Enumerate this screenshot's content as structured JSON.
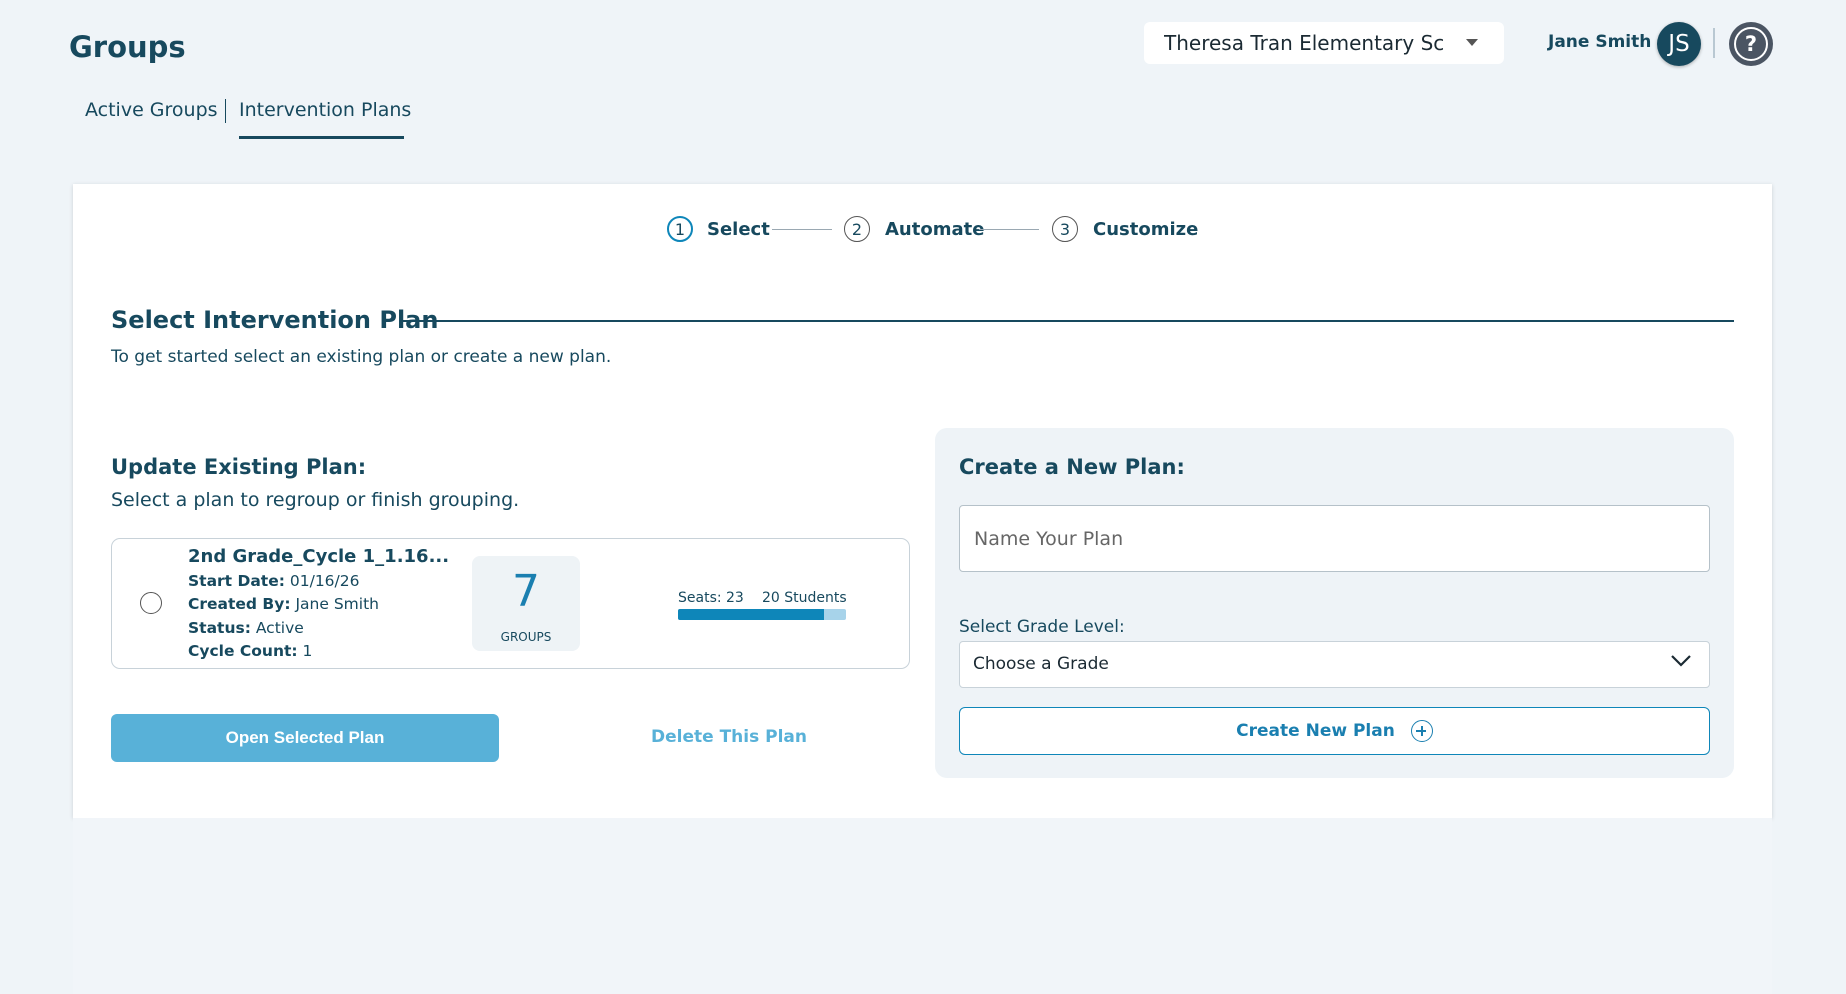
{
  "header": {
    "title": "Groups",
    "school": "Theresa Tran Elementary School",
    "user_name": "Jane Smith",
    "user_initials": "JS",
    "help_glyph": "?"
  },
  "tabs": [
    {
      "label": "Active Groups",
      "active": false
    },
    {
      "label": "Intervention Plans",
      "active": true
    }
  ],
  "steps": [
    {
      "number": "1",
      "label": "Select",
      "active": true
    },
    {
      "number": "2",
      "label": "Automate",
      "active": false
    },
    {
      "number": "3",
      "label": "Customize",
      "active": false
    }
  ],
  "section": {
    "title": "Select Intervention Plan",
    "subtitle": "To get started select an existing plan or create a new plan."
  },
  "update": {
    "heading": "Update Existing Plan:",
    "subtitle": "Select a plan to regroup or finish grouping.",
    "plan": {
      "name": "2nd Grade_Cycle 1_1.16...",
      "start_date_label": "Start Date:",
      "start_date": "01/16/26",
      "created_by_label": "Created By:",
      "created_by": "Jane Smith",
      "status_label": "Status:",
      "status": "Active",
      "cycle_count_label": "Cycle Count:",
      "cycle_count": "1",
      "groups_count": "7",
      "groups_label": "GROUPS",
      "seats_label": "Seats: 23",
      "students_label": "20 Students",
      "seats": 23,
      "students": 20
    },
    "open_button": "Open Selected Plan",
    "delete_link": "Delete This Plan"
  },
  "create": {
    "heading": "Create a New Plan:",
    "name_placeholder": "Name Your Plan",
    "grade_label": "Select Grade Level:",
    "grade_selected": "Choose a Grade",
    "create_button": "Create New Plan"
  },
  "colors": {
    "primary": "#17495e",
    "accent": "#0e86b9",
    "button_disabled": "#58b1d8",
    "background": "#eff4f8"
  }
}
